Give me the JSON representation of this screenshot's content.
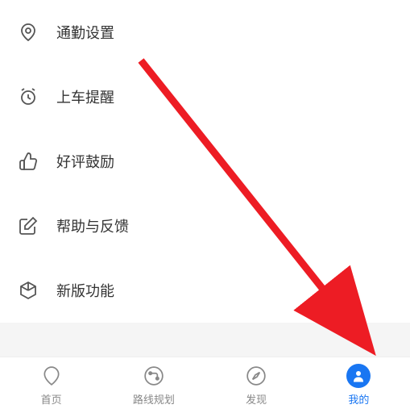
{
  "settings": {
    "items": [
      {
        "icon": "location-pin-icon",
        "label": "通勤设置"
      },
      {
        "icon": "alarm-icon",
        "label": "上车提醒"
      },
      {
        "icon": "thumbs-up-icon",
        "label": "好评鼓励"
      },
      {
        "icon": "edit-box-icon",
        "label": "帮助与反馈"
      },
      {
        "icon": "cube-icon",
        "label": "新版功能"
      }
    ]
  },
  "nav": {
    "items": [
      {
        "icon": "home-pin-icon",
        "label": "首页",
        "active": false
      },
      {
        "icon": "route-icon",
        "label": "路线规划",
        "active": false
      },
      {
        "icon": "compass-icon",
        "label": "发现",
        "active": false
      },
      {
        "icon": "profile-icon",
        "label": "我的",
        "active": true
      }
    ]
  },
  "annotation": {
    "arrow_color": "#ed1c24",
    "description": "arrow pointing to profile tab"
  }
}
